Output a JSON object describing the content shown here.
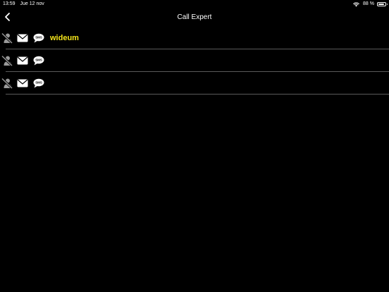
{
  "status_bar": {
    "time": "13:59",
    "date": "Jue 12 nov",
    "battery_text": "88 %",
    "battery_level": 0.88,
    "icons": [
      "wifi-icon",
      "battery-icon"
    ]
  },
  "nav": {
    "title": "Call Expert",
    "back_icon": "chevron-left-icon"
  },
  "colors": {
    "background": "#000000",
    "name_accent": "#f4e51b",
    "icon_grey": "#9a9a9a",
    "divider": "#5a5a5a"
  },
  "contacts": [
    {
      "name": "wideum",
      "icons": [
        "no-call-icon",
        "mail-icon",
        "sms-icon"
      ]
    },
    {
      "name": "",
      "icons": [
        "no-call-icon",
        "mail-icon",
        "sms-icon"
      ]
    },
    {
      "name": "",
      "icons": [
        "no-call-icon",
        "mail-icon",
        "sms-icon"
      ]
    }
  ],
  "sms_icon_label": "SMS"
}
